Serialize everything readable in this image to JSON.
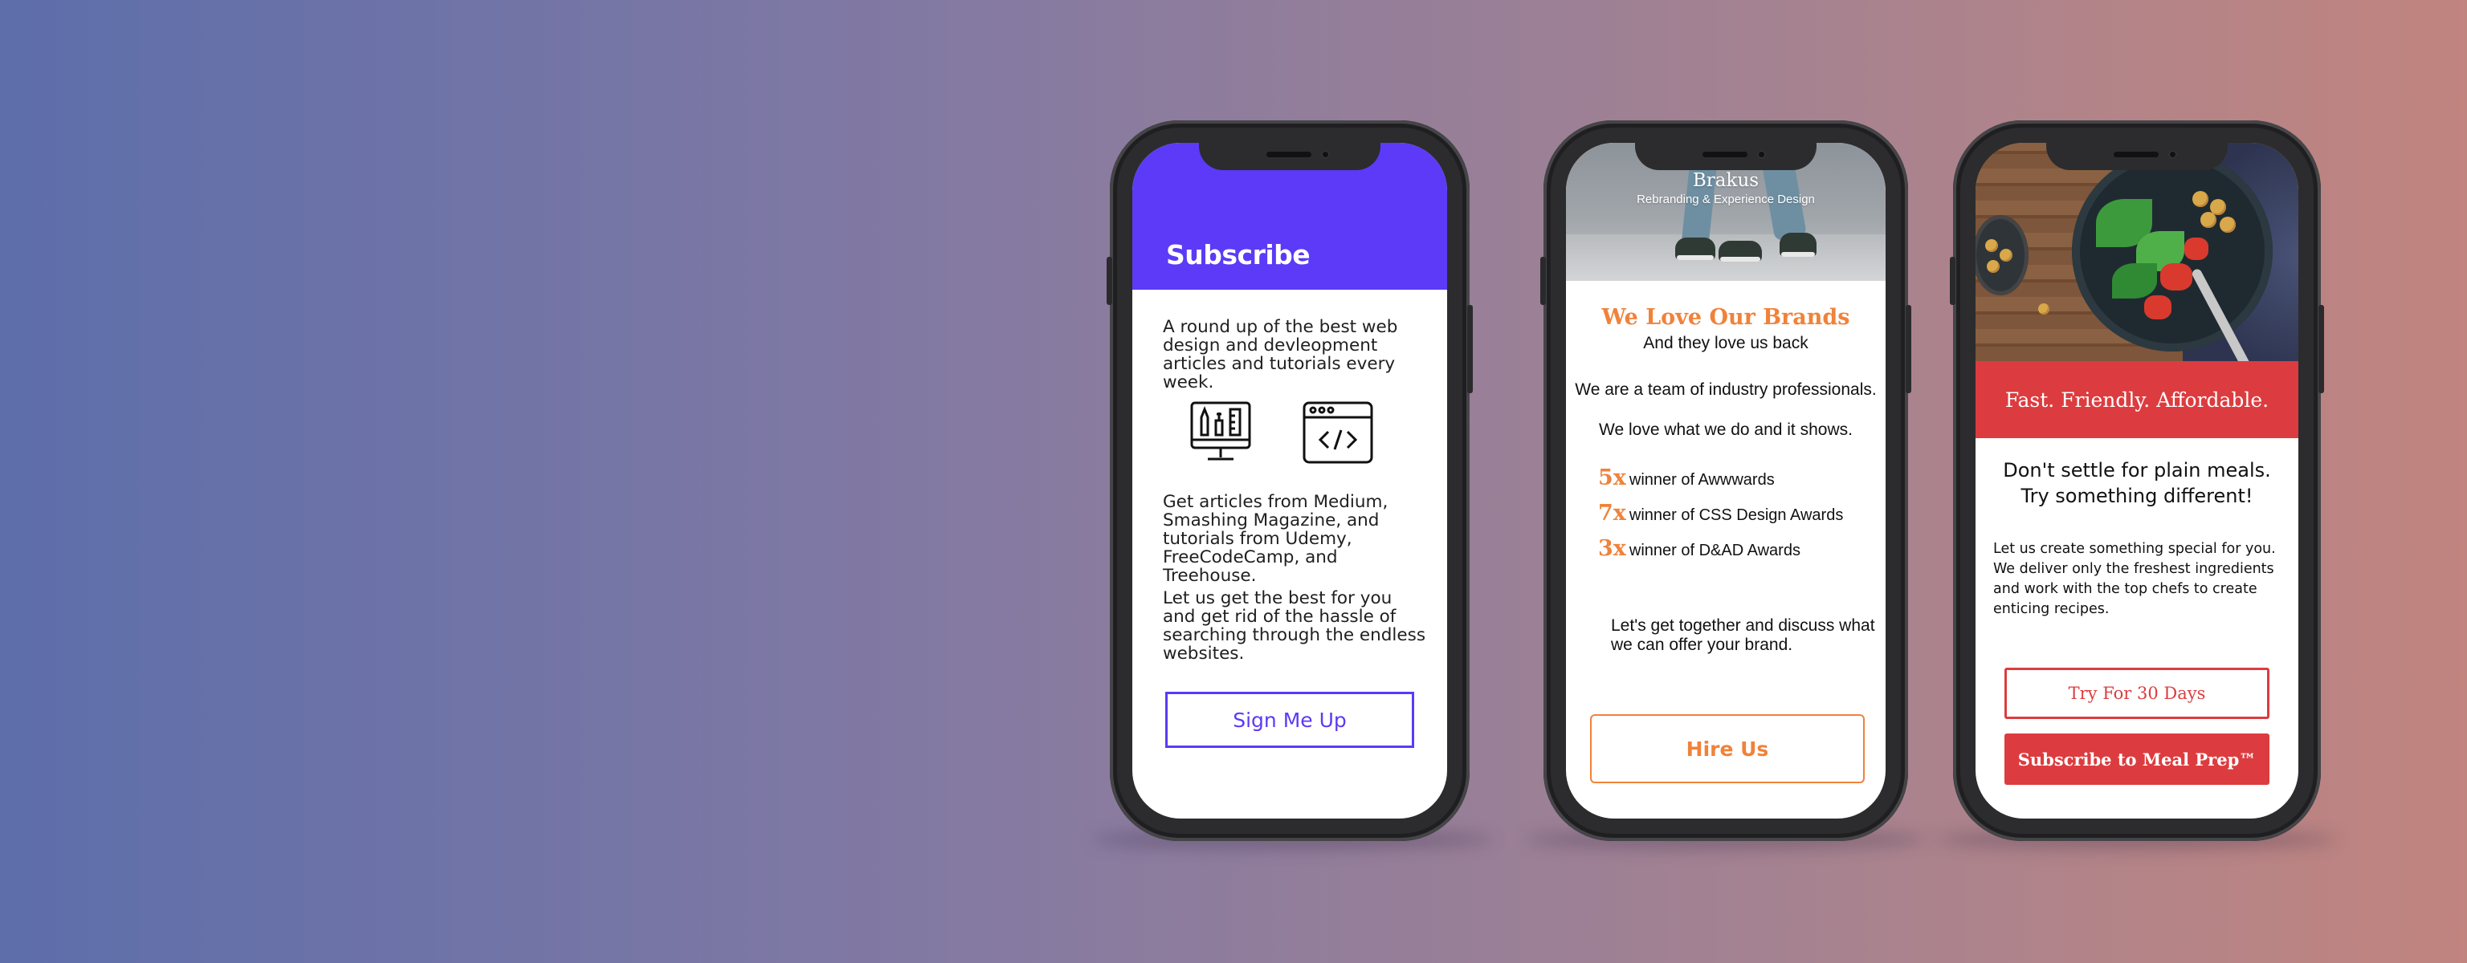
{
  "phones": [
    {
      "header_title": "Subscribe",
      "intro": "A round up of the best web design and devleopment articles and tutorials every week.",
      "icons": [
        "design-tools-monitor-icon",
        "code-window-icon"
      ],
      "sources": "Get articles from Medium, Smashing Magazine, and tutorials from Udemy, FreeCodeCamp, and Treehouse.",
      "pitch": "Let us get the best for you and get rid of the hassle of searching through the endless websites.",
      "button_label": "Sign Me Up",
      "accent_color": "#5c3af7"
    },
    {
      "brand": "Brakus",
      "tagline": "Rebranding & Experience Design",
      "title": "We Love Our Brands",
      "subtitle": "And they love us back",
      "team": "We are a team of industry professionals.",
      "love": "We love what we do and it shows.",
      "awards": [
        {
          "multiplier": "5x",
          "text": "winner of Awwwards"
        },
        {
          "multiplier": "7x",
          "text": "winner of CSS Design Awards"
        },
        {
          "multiplier": "3x",
          "text": "winner of D&AD Awards"
        }
      ],
      "cta_text": "Let's get together and discuss what we can offer your brand.",
      "button_label": "Hire Us",
      "accent_color": "#f0823a"
    },
    {
      "band_text": "Fast. Friendly. Affordable.",
      "headline_line1": "Don't settle for plain meals.",
      "headline_line2": "Try something different!",
      "body": "Let us create something special for you. We deliver only the freshest ingredients and work with the top chefs to create enticing recipes.",
      "secondary_button_label": "Try For 30 Days",
      "primary_button_label": "Subscribe to Meal Prep™",
      "accent_color": "#dc3c3f"
    }
  ]
}
